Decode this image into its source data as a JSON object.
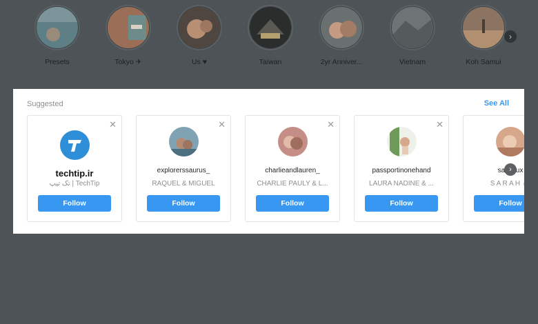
{
  "highlights": [
    {
      "label": "Presets",
      "color": "#5f7f86"
    },
    {
      "label": "Tokyo ✈",
      "color": "#9b6e58"
    },
    {
      "label": "Us ♥",
      "color": "#7e6a5c"
    },
    {
      "label": "Taiwan",
      "color": "#3a3d3b"
    },
    {
      "label": "2yr Anniver...",
      "color": "#8a6b5b"
    },
    {
      "label": "Vietnam",
      "color": "#6e7375"
    },
    {
      "label": "Koh Samui",
      "color": "#b09070"
    }
  ],
  "highlights_next_icon": "chevron-right-icon",
  "suggested": {
    "heading": "Suggested",
    "see_all": "See All",
    "cards": [
      {
        "username": "techtip.ir",
        "fullname": "تک تیپ | TechTip",
        "follow": "Follow",
        "avatar_color": "#2e8fd8"
      },
      {
        "username": "explorerssaurus_",
        "fullname": "RAQUEL & MIGUEL",
        "follow": "Follow",
        "avatar_color": "#7fa3b3"
      },
      {
        "username": "charlieandlauren_",
        "fullname": "CHARLIE PAULY & L...",
        "follow": "Follow",
        "avatar_color": "#c48d86"
      },
      {
        "username": "passportinonehand",
        "fullname": "LAURA NADINE & ...",
        "follow": "Follow",
        "avatar_color": "#d9c49a"
      },
      {
        "username": "saltydux",
        "fullname": "S A R A H 🤞",
        "follow": "Follow",
        "avatar_color": "#d6a78a"
      }
    ],
    "close_icon": "close-icon",
    "next_icon": "chevron-right-icon"
  }
}
